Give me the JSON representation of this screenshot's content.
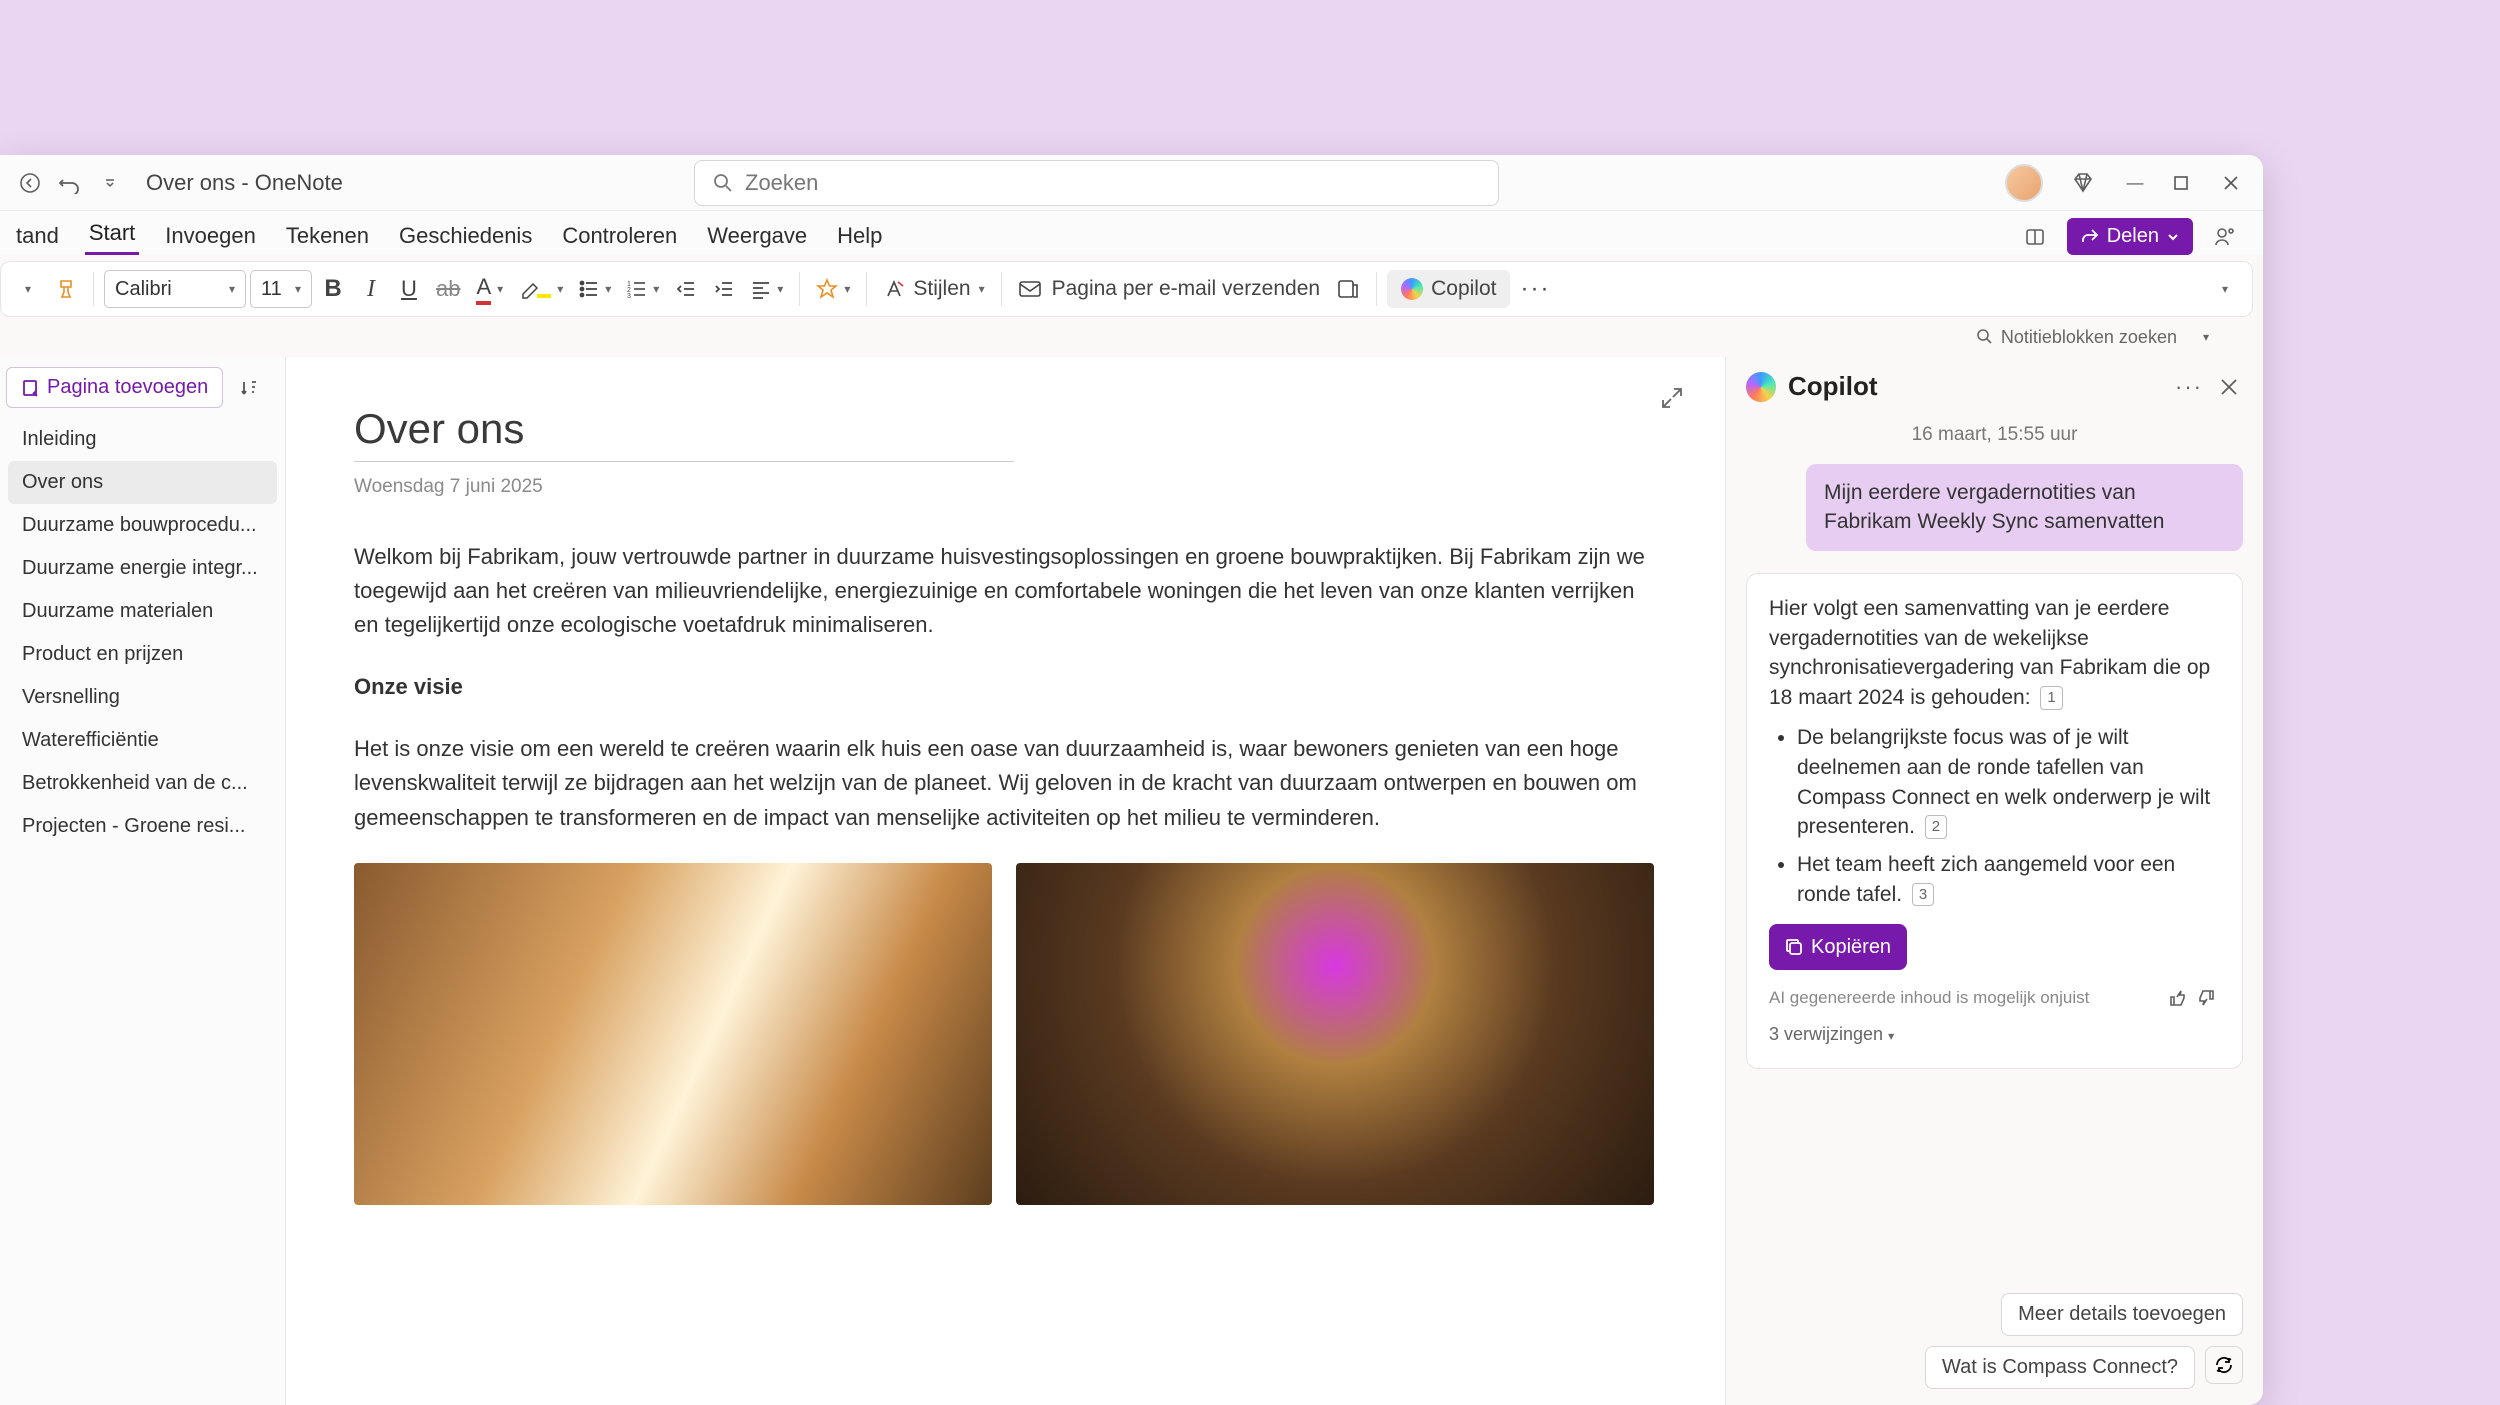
{
  "titlebar": {
    "app_title": "Over ons - OneNote",
    "search_placeholder": "Zoeken"
  },
  "ribbon": {
    "tabs": [
      "tand",
      "Start",
      "Invoegen",
      "Tekenen",
      "Geschiedenis",
      "Controleren",
      "Weergave",
      "Help"
    ],
    "active_index": 1,
    "share": "Delen"
  },
  "toolbar": {
    "font_name": "Calibri",
    "font_size": "11",
    "styles": "Stijlen",
    "email_page": "Pagina per e-mail verzenden",
    "copilot": "Copilot"
  },
  "nbsearch": "Notitieblokken zoeken",
  "pagelist": {
    "add_page": "Pagina toevoegen",
    "items": [
      "Inleiding",
      "Over ons",
      "Duurzame bouwprocedu...",
      "Duurzame energie integr...",
      "Duurzame materialen",
      "Product en prijzen",
      "Versnelling",
      "Waterefficiëntie",
      "Betrokkenheid van de c...",
      "Projecten - Groene resi..."
    ],
    "selected_index": 1
  },
  "note": {
    "title": "Over ons",
    "date": "Woensdag 7 juni 2025",
    "para1": "Welkom bij Fabrikam, jouw vertrouwde partner in duurzame huisvestingsoplossingen en groene bouwpraktijken. Bij Fabrikam zijn we toegewijd aan het creëren van milieuvriendelijke, energiezuinige en comfortabele woningen die het leven van onze klanten verrijken en tegelijkertijd onze ecologische voetafdruk minimaliseren.",
    "h1": "Onze visie",
    "para2": "Het is onze visie om een wereld te creëren waarin elk huis een oase van duurzaamheid is, waar bewoners genieten van een hoge levenskwaliteit terwijl ze bijdragen aan het welzijn van de planeet. Wij geloven in de kracht van duurzaam ontwerpen en bouwen om gemeenschappen te transformeren en de impact van menselijke activiteiten op het milieu te verminderen."
  },
  "copilot": {
    "title": "Copilot",
    "timestamp": "16 maart, 15:55 uur",
    "user_msg": "Mijn eerdere vergadernotities van Fabrikam Weekly Sync samenvatten",
    "ai_intro": "Hier volgt een samenvatting van je eerdere vergadernotities van de wekelijkse synchronisatievergadering van Fabrikam die op 18 maart 2024 is gehouden:",
    "ref1": "1",
    "bullet1": "De belangrijkste focus was of je wilt deelnemen aan de ronde tafellen van Compass Connect en welk onderwerp je wilt presenteren.",
    "ref2": "2",
    "bullet2": "Het team heeft zich aangemeld voor een ronde tafel.",
    "ref3": "3",
    "copy": "Kopiëren",
    "disclaimer": "AI gegenereerde inhoud is mogelijk onjuist",
    "references": "3 verwijzingen",
    "sugg1": "Meer details toevoegen",
    "sugg2": "Wat is Compass Connect?"
  }
}
